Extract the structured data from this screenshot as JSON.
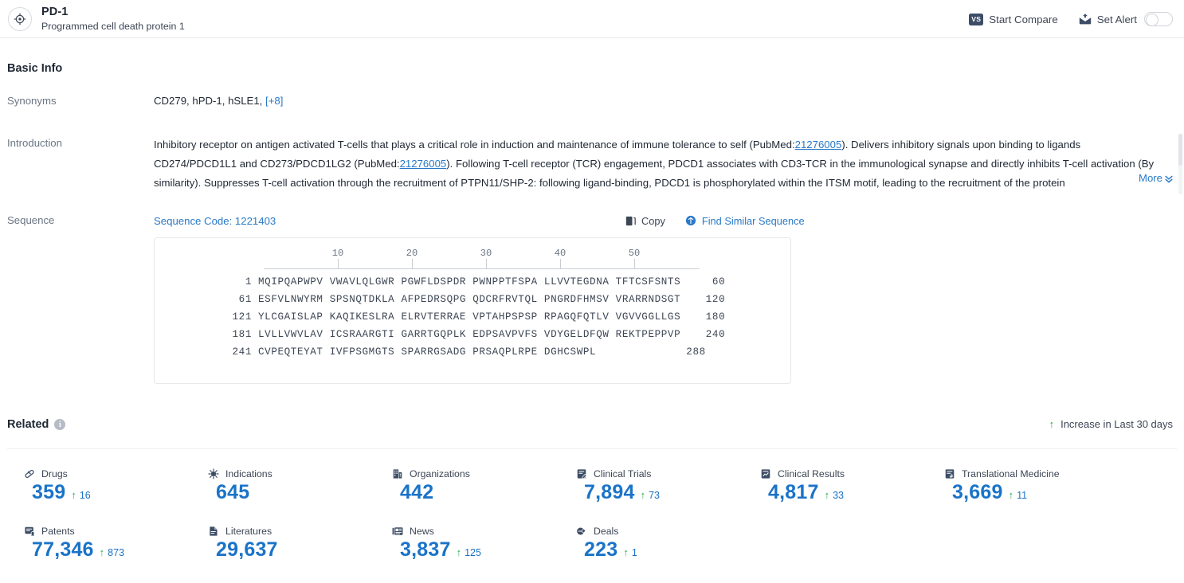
{
  "header": {
    "icon": "target-icon",
    "title": "PD-1",
    "subtitle": "Programmed cell death protein 1",
    "start_compare_label": "Start Compare",
    "start_compare_badge": "VS",
    "set_alert_label": "Set Alert",
    "alert_toggle_state": "off"
  },
  "basic_info": {
    "title": "Basic Info",
    "synonyms_label": "Synonyms",
    "synonyms_value": "CD279,  hPD-1,  hSLE1,",
    "synonyms_more": "[+8]",
    "introduction_label": "Introduction",
    "introduction_p1_a": "Inhibitory receptor on antigen activated T-cells that plays a critical role in induction and maintenance of immune tolerance to self (PubMed:",
    "introduction_link1": "21276005",
    "introduction_p1_b": "). Delivers inhibitory signals upon binding to ligands CD274/PDCD1L1 and CD273/PDCD1LG2 (PubMed:",
    "introduction_link2": "21276005",
    "introduction_p1_c": "). Following T-cell receptor (TCR) engagement, PDCD1 associates with CD3-TCR in the immunological synapse and directly inhibits T-cell activation (By similarity). Suppresses T-cell activation through the recruitment of PTPN11/SHP-2: following ligand-binding, PDCD1 is phosphorylated within the ITSM motif, leading to the recruitment of the protein",
    "more_label": "More"
  },
  "sequence": {
    "label": "Sequence",
    "code_label": "Sequence Code: 1221403",
    "copy_label": "Copy",
    "find_similar_label": "Find Similar Sequence",
    "ruler_ticks": [
      "10",
      "20",
      "30",
      "40",
      "50"
    ],
    "rows": [
      {
        "start": "1",
        "chunks": "MQIPQAPWPV VWAVLQLGWR PGWFLDSPDR PWNPPTFSPA LLVVTEGDNA TFTCSFSNTS",
        "end": "60"
      },
      {
        "start": "61",
        "chunks": "ESFVLNWYRM SPSNQTDKLA AFPEDRSQPG QDCRFRVTQL PNGRDFHMSV VRARRNDSGT",
        "end": "120"
      },
      {
        "start": "121",
        "chunks": "YLCGAISLAP KAQIKESLRA ELRVTERRAE VPTAHPSPSP RPAGQFQTLV VGVVGGLLGS",
        "end": "180"
      },
      {
        "start": "181",
        "chunks": "LVLLVWVLAV ICSRAARGTI GARRTGQPLK EDPSAVPVFS VDYGELDFQW REKTPEPPVP",
        "end": "240"
      },
      {
        "start": "241",
        "chunks": "CVPEQTEYAT IVFPSGMGTS SPARRGSADG PRSAQPLRPE DGHCSWPL",
        "end": "288"
      }
    ]
  },
  "related": {
    "title": "Related",
    "info_glyph": "i",
    "increase_note": "Increase in Last 30 days",
    "increase_arrow": "↑",
    "stats": [
      {
        "icon": "pill-icon",
        "name": "Drugs",
        "value": "359",
        "delta": "16"
      },
      {
        "icon": "virus-icon",
        "name": "Indications",
        "value": "645",
        "delta": ""
      },
      {
        "icon": "building-icon",
        "name": "Organizations",
        "value": "442",
        "delta": ""
      },
      {
        "icon": "clipboard-pen-icon",
        "name": "Clinical Trials",
        "value": "7,894",
        "delta": "73"
      },
      {
        "icon": "chart-doc-icon",
        "name": "Clinical Results",
        "value": "4,817",
        "delta": "33"
      },
      {
        "icon": "transfer-doc-icon",
        "name": "Translational Medicine",
        "value": "3,669",
        "delta": "11"
      },
      {
        "icon": "patent-doc-icon",
        "name": "Patents",
        "value": "77,346",
        "delta": "873"
      },
      {
        "icon": "literature-icon",
        "name": "Literatures",
        "value": "29,637",
        "delta": ""
      },
      {
        "icon": "newspaper-icon",
        "name": "News",
        "value": "3,837",
        "delta": "125"
      },
      {
        "icon": "handshake-icon",
        "name": "Deals",
        "value": "223",
        "delta": "1"
      }
    ]
  },
  "colors": {
    "link_blue": "#2979c8",
    "value_blue": "#1a73c8",
    "increase_green": "#2fa84f",
    "badge_navy": "#3d4d66"
  }
}
